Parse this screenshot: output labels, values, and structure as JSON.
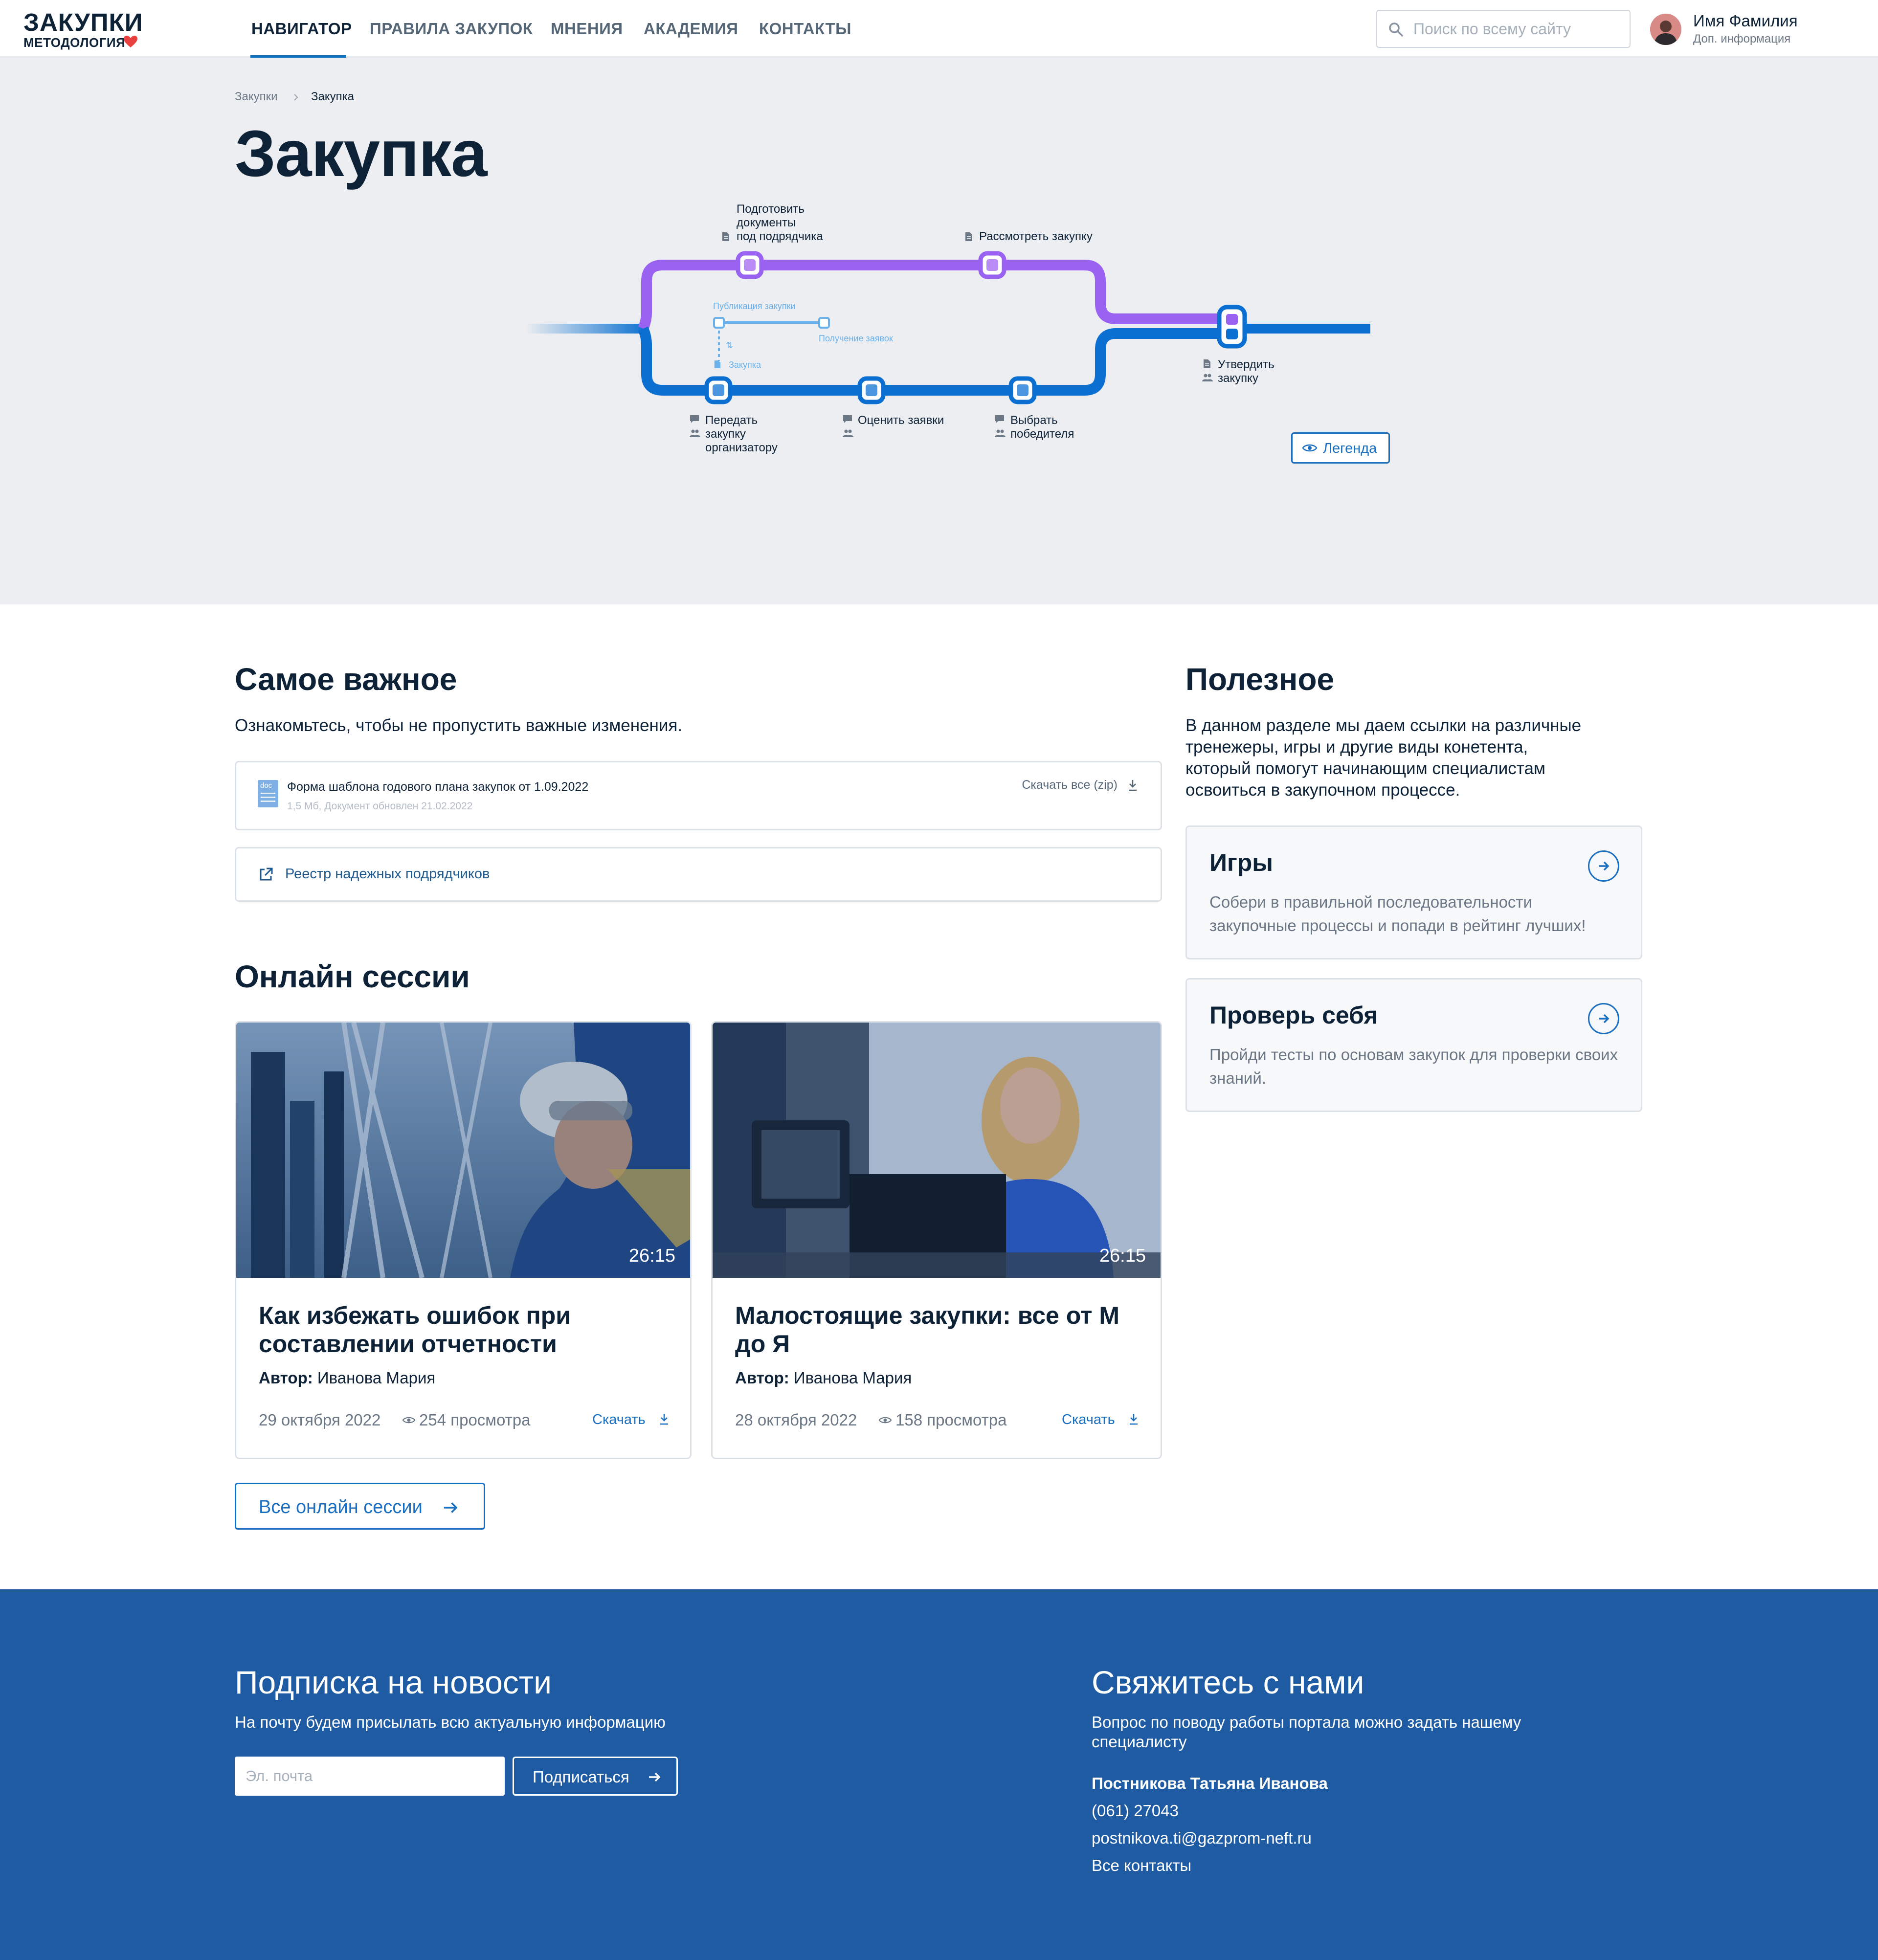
{
  "brand": {
    "title": "ЗАКУПКИ",
    "subtitle": "МЕТОДОЛОГИЯ"
  },
  "nav": {
    "items": [
      "НАВИГАТОР",
      "ПРАВИЛА ЗАКУПОК",
      "МНЕНИЯ",
      "АКАДЕМИЯ",
      "КОНТАКТЫ"
    ],
    "active": "НАВИГАТОР"
  },
  "search": {
    "placeholder": "Поиск по всему сайту"
  },
  "user": {
    "name": "Имя Фамилия",
    "sub": "Доп. информация"
  },
  "breadcrumb": [
    "Закупки",
    "Закупка"
  ],
  "page_title": "Закупка",
  "map": {
    "top_stations": [
      "Подготовить документы под подрядчика",
      "Рассмотреть закупку"
    ],
    "top_station_lines": [
      [
        "Подготовить",
        "документы",
        "под подрядчика"
      ],
      [
        "Рассмотреть закупку"
      ]
    ],
    "sub_line": {
      "start": "Публикация закупки",
      "end": "Получение заявок",
      "doc": "Закупка"
    },
    "bottom_stations": [
      "Передать закупку организатору",
      "Оценить заявки",
      "Выбрать победителя"
    ],
    "bottom_station_lines": [
      [
        "Передать",
        "закупку",
        "организатору"
      ],
      [
        "Оценить заявки"
      ],
      [
        "Выбрать",
        "победителя"
      ]
    ],
    "end_station_lines": [
      "Утвердить",
      "закупку"
    ],
    "colors": {
      "purple": "#9a62f0",
      "blue": "#0a6fd0",
      "light_blue": "#6ab0ea"
    }
  },
  "legend_button": "Легенда",
  "important": {
    "title": "Самое важное",
    "lead": "Ознакомьтесь, чтобы не пропустить важные изменения.",
    "doc": {
      "icon_label": "doc",
      "name": "Форма шаблона годового плана закупок от 1.09.2022",
      "meta": "1,5 Мб, Документ обновлен 21.02.2022",
      "download": "Скачать все (zip)"
    },
    "registry": "Реестр надежных подрядчиков"
  },
  "useful": {
    "title": "Полезное",
    "lead_lines": [
      "В данном разделе мы даем ссылки на различные",
      "тренежеры, игры и другие виды конетента,",
      "который помогут начинающим специалистам",
      "освоиться в закупочном процессе."
    ],
    "cards": [
      {
        "title": "Игры",
        "desc": "Собери в правильной последовательности закупочные процессы и попади в рейтинг лучших!"
      },
      {
        "title": "Проверь себя",
        "desc": "Пройди тесты по основам закупок для проверки своих знаний."
      }
    ]
  },
  "sessions": {
    "title": "Онлайн сессии",
    "author_label": "Автор:",
    "items": [
      {
        "title": "Как избежать ошибок при составлении отчетности",
        "author": "Иванова Мария",
        "date": "29 октября 2022",
        "views": "254 просмотра",
        "duration": "26:15",
        "download": "Скачать"
      },
      {
        "title": "Малостоящие закупки: все от М до Я",
        "author": "Иванова Мария",
        "date": "28 октября 2022",
        "views": "158 просмотра",
        "duration": "26:15",
        "download": "Скачать"
      }
    ],
    "all_button": "Все онлайн сессии"
  },
  "footer": {
    "subscribe_title": "Подписка на новости",
    "subscribe_text": "На почту будем присылать всю актуальную информацию",
    "email_placeholder": "Эл. почта",
    "subscribe_button": "Подписаться",
    "contact_title": "Свяжитесь с нами",
    "contact_text_lines": [
      "Вопрос по поводу работы портала можно задать нашему",
      "специалисту"
    ],
    "contact_name": "Постникова Татьяна Иванова",
    "contact_phone": "(061) 27043",
    "contact_email": "postnikova.ti@gazprom-neft.ru",
    "all_contacts": "Все контакты"
  }
}
